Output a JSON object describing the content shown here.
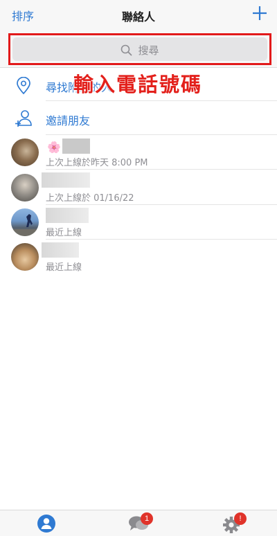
{
  "header": {
    "sort_label": "排序",
    "title": "聯絡人"
  },
  "search": {
    "placeholder": "搜尋"
  },
  "actions": [
    {
      "label": "尋找附近的人",
      "icon": "location-pin-icon"
    },
    {
      "label": "邀請朋友",
      "icon": "add-person-icon"
    }
  ],
  "overlay": {
    "text": "輸入電話號碼"
  },
  "contacts": [
    {
      "status": "上次上線於昨天 8:00 PM",
      "emoji": "🌸"
    },
    {
      "status": "上次上線於 01/16/22"
    },
    {
      "status": "最近上線"
    },
    {
      "status": "最近上線"
    }
  ],
  "tabs": [
    {
      "name": "contacts-tab",
      "icon": "person-icon",
      "active": true,
      "badge": ""
    },
    {
      "name": "chats-tab",
      "icon": "chat-bubbles-icon",
      "active": false,
      "badge": "1"
    },
    {
      "name": "settings-tab",
      "icon": "gear-icon",
      "active": false,
      "badge": "!"
    }
  ],
  "colors": {
    "accent": "#2f7ad2",
    "highlight": "#e2191a",
    "badge": "#e0332a"
  }
}
